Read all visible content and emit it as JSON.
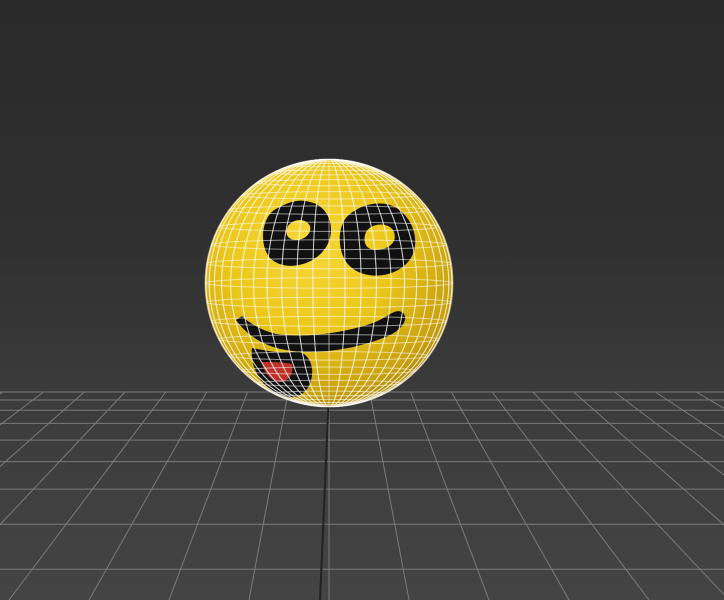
{
  "viewport": {
    "view": "perspective",
    "background_top": "#2a2a2a",
    "background_bottom": "#444444"
  },
  "ground_grid": {
    "visible": true,
    "line_color": "#7a7a7a",
    "center_line_color": "#222222"
  },
  "object": {
    "type": "sphere",
    "shading": "textured",
    "wireframe_overlay": true,
    "base_color": "#ecc71a",
    "shadow_color": "#8a6b00",
    "wireframe_color": "#ffffff",
    "texture": {
      "description_icon": "smiley-face-icon",
      "eye_color": "#111111",
      "tongue_color": "#c0302a"
    }
  }
}
